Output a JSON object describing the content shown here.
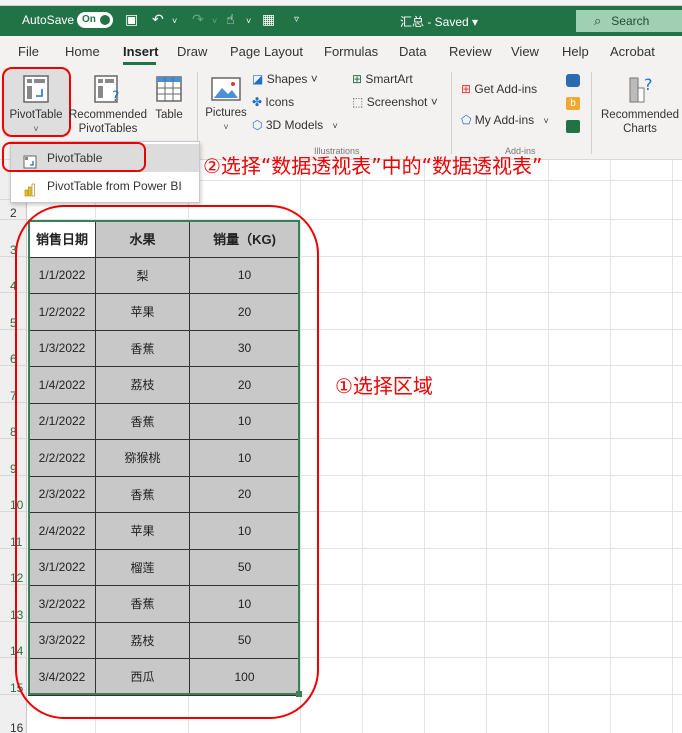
{
  "titlebar": {
    "autosave_label": "AutoSave",
    "autosave_state": "On",
    "doc_title": "汇总 - Saved ▾",
    "search_placeholder": "Search",
    "accent": "#217346"
  },
  "tabs": [
    {
      "label": "File"
    },
    {
      "label": "Home"
    },
    {
      "label": "Insert",
      "active": true
    },
    {
      "label": "Draw"
    },
    {
      "label": "Page Layout"
    },
    {
      "label": "Formulas"
    },
    {
      "label": "Data"
    },
    {
      "label": "Review"
    },
    {
      "label": "View"
    },
    {
      "label": "Help"
    },
    {
      "label": "Acrobat"
    }
  ],
  "ribbon": {
    "pivottable": "PivotTable",
    "recommended_pivottables_1": "Recommended",
    "recommended_pivottables_2": "PivotTables",
    "table": "Table",
    "pictures": "Pictures",
    "shapes": "Shapes ˅",
    "icons": "Icons",
    "models3d": "3D Models",
    "smartart": "SmartArt",
    "screenshot": "Screenshot ˅",
    "illustrations_group": "Illustrations",
    "get_addins": "Get Add-ins",
    "my_addins": "My Add-ins",
    "addins_group": "Add-ins",
    "recommended_charts_1": "Recommended",
    "recommended_charts_2": "Charts"
  },
  "dropdown": {
    "items": [
      {
        "label": "PivotTable",
        "highlighted": true
      },
      {
        "label": "PivotTable from Power BI"
      }
    ]
  },
  "annotations": {
    "step1": "①选择区域",
    "step2": "②选择“数据透视表”中的“数据透视表”"
  },
  "sheet": {
    "row_numbers": [
      "2",
      "3",
      "4",
      "5",
      "6",
      "7",
      "8",
      "9",
      "10",
      "11",
      "12",
      "13",
      "14",
      "15",
      "16"
    ],
    "headers": [
      "销售日期",
      "水果",
      "销量（KG)"
    ],
    "rows": [
      [
        "1/1/2022",
        "梨",
        "10"
      ],
      [
        "1/2/2022",
        "苹果",
        "20"
      ],
      [
        "1/3/2022",
        "香蕉",
        "30"
      ],
      [
        "1/4/2022",
        "荔枝",
        "20"
      ],
      [
        "2/1/2022",
        "香蕉",
        "10"
      ],
      [
        "2/2/2022",
        "猕猴桃",
        "10"
      ],
      [
        "2/3/2022",
        "香蕉",
        "20"
      ],
      [
        "2/4/2022",
        "苹果",
        "10"
      ],
      [
        "3/1/2022",
        "榴莲",
        "50"
      ],
      [
        "3/2/2022",
        "香蕉",
        "10"
      ],
      [
        "3/3/2022",
        "荔枝",
        "50"
      ],
      [
        "3/4/2022",
        "西瓜",
        "100"
      ]
    ]
  }
}
